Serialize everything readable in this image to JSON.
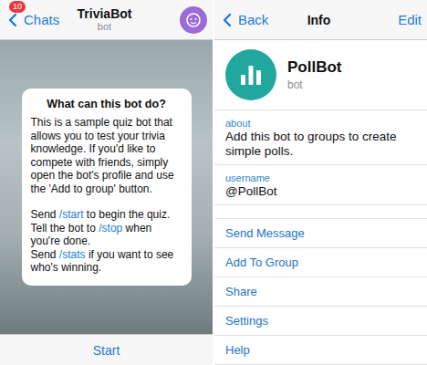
{
  "left": {
    "nav": {
      "back": "Chats",
      "badge": "10",
      "title": "TriviaBot",
      "subtitle": "bot"
    },
    "card": {
      "title": "What can this bot do?",
      "paragraphs": [
        {
          "lines": [
            [
              {
                "text": "This is a sample quiz bot that allows you to test your trivia knowledge. If you'd like to compete with friends, simply open the bot's profile and use the 'Add to group' button.",
                "kind": "text"
              }
            ]
          ]
        },
        {
          "lines": [
            [
              {
                "text": "Send ",
                "kind": "text"
              },
              {
                "text": "/start",
                "kind": "command"
              },
              {
                "text": " to begin the quiz. Tell the bot to ",
                "kind": "text"
              },
              {
                "text": "/stop",
                "kind": "command"
              },
              {
                "text": " when you're done.",
                "kind": "text"
              }
            ],
            [
              {
                "text": "Send ",
                "kind": "text"
              },
              {
                "text": "/stats",
                "kind": "command"
              },
              {
                "text": " if you want to see who's winning.",
                "kind": "text"
              }
            ]
          ]
        }
      ]
    },
    "start_button": "Start"
  },
  "right": {
    "nav": {
      "back": "Back",
      "title": "Info",
      "edit": "Edit"
    },
    "profile": {
      "name": "PollBot",
      "subtitle": "bot"
    },
    "fields": [
      {
        "label": "about",
        "value": "Add this bot to groups to create simple polls."
      },
      {
        "label": "username",
        "value": "@PollBot"
      }
    ],
    "actions": [
      "Send Message",
      "Add To Group",
      "Share",
      "Settings",
      "Help"
    ]
  }
}
